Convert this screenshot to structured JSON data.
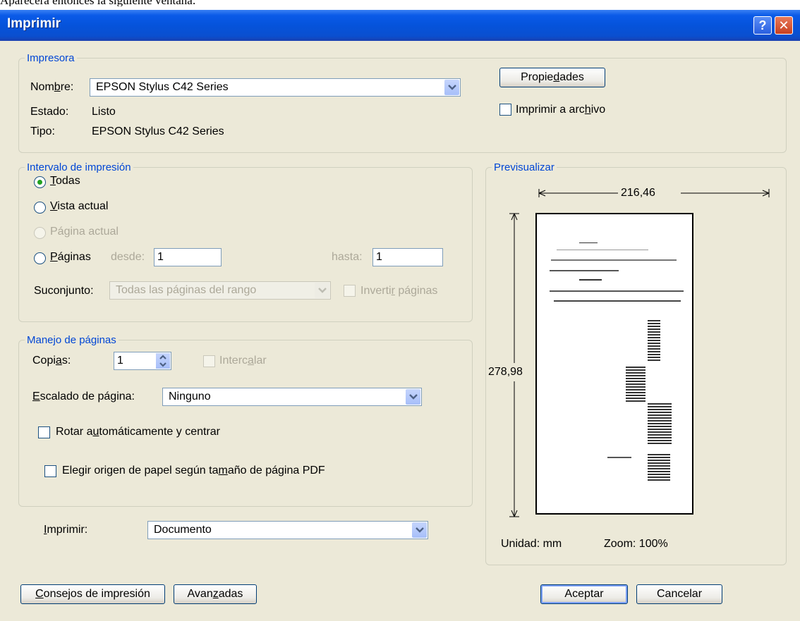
{
  "caption": "Aparecerá entonces la siguiente ventana:",
  "window": {
    "title": "Imprimir",
    "help": "?",
    "close": "✕"
  },
  "printer": {
    "legend": "Impresora",
    "name_label": {
      "pre": "Nom",
      "ul": "b",
      "post": "re:"
    },
    "name_value": "EPSON Stylus C42 Series",
    "status_label": "Estado:",
    "status_value": "Listo",
    "type_label": "Tipo:",
    "type_value": "EPSON Stylus C42 Series",
    "properties_button": {
      "pre": "Propie",
      "ul": "d",
      "post": "ades"
    },
    "print_to_file": {
      "pre": "Imprimir a arc",
      "ul": "h",
      "post": "ivo"
    }
  },
  "range": {
    "legend": "Intervalo de impresión",
    "all": {
      "pre": "",
      "ul": "T",
      "post": "odas"
    },
    "current_view": {
      "pre": "",
      "ul": "V",
      "post": "ista actual"
    },
    "current_page": "Página actual",
    "pages": {
      "pre": "",
      "ul": "P",
      "post": "áginas"
    },
    "from_label": "desde:",
    "from_value": "1",
    "to_label": "hasta:",
    "to_value": "1",
    "subset_label": "Suconjunto:",
    "subset_value": "Todas las páginas del rango",
    "reverse": {
      "pre": "Inverti",
      "ul": "r",
      "post": " páginas"
    },
    "selected": "all"
  },
  "handling": {
    "legend": "Manejo de páginas",
    "copies_label": {
      "pre": "Copi",
      "ul": "a",
      "post": "s:"
    },
    "copies_value": "1",
    "collate": {
      "pre": "Interc",
      "ul": "a",
      "post": "lar"
    },
    "scaling_label": {
      "pre": "",
      "ul": "E",
      "post": "scalado de página:"
    },
    "scaling_value": "Ninguno",
    "auto_rotate": {
      "pre": "Rotar a",
      "ul": "u",
      "post": "tomáticamente y centrar"
    },
    "paper_source": {
      "pre": "Elegir origen de papel según ta",
      "ul": "m",
      "post": "año de página PDF"
    }
  },
  "print_what": {
    "label": {
      "pre": "",
      "ul": "I",
      "post": "mprimir:"
    },
    "value": "Documento"
  },
  "preview": {
    "legend": "Previsualizar",
    "width": "216,46",
    "height": "278,98",
    "unit": "Unidad: mm",
    "zoom": "Zoom: 100%"
  },
  "buttons": {
    "tips": {
      "pre": "",
      "ul": "C",
      "post": "onsejos de impresión"
    },
    "advanced": {
      "pre": "Avan",
      "ul": "z",
      "post": "adas"
    },
    "ok": "Aceptar",
    "cancel": "Cancelar"
  },
  "colors": {
    "titlebar": "#0553db",
    "dialog_bg": "#ece9d8",
    "legend": "#0046d5",
    "radio_dot": "#21a121"
  }
}
